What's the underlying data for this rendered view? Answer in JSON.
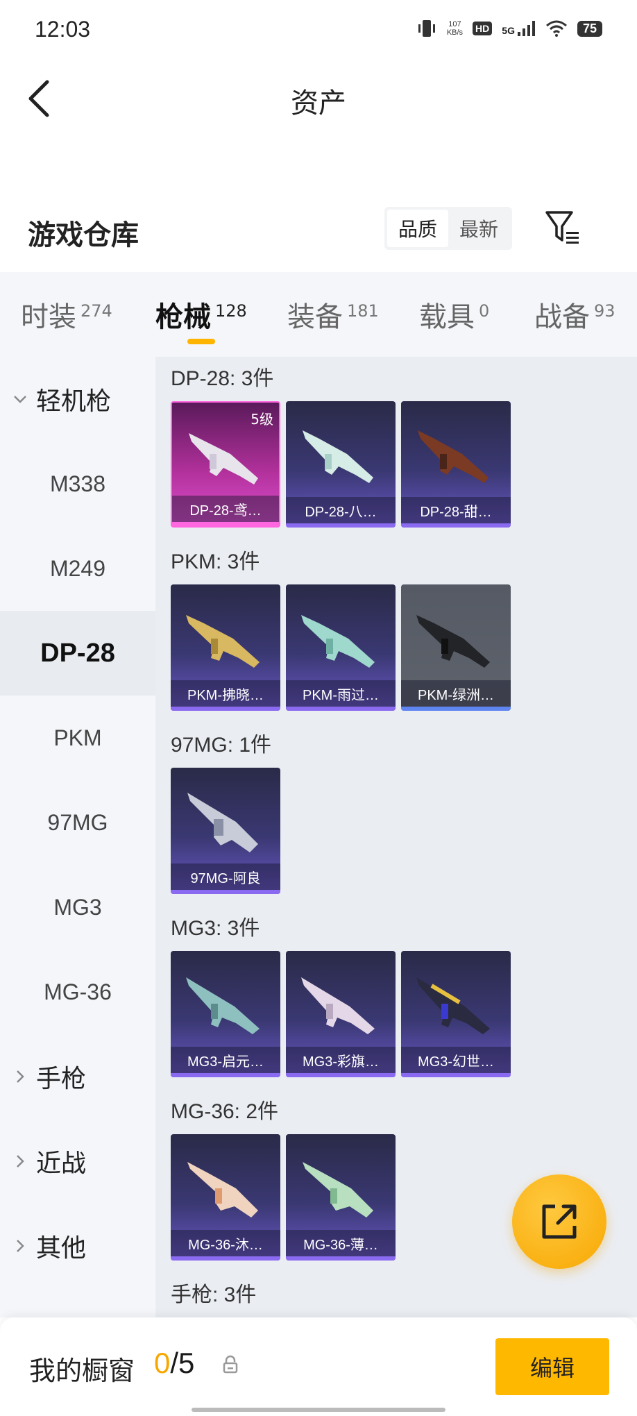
{
  "status_bar": {
    "time": "12:03",
    "net_speed_value": "107",
    "net_speed_unit": "KB/s",
    "hd_badge": "HD",
    "network": "5G",
    "battery": "75",
    "icons": [
      "vibrate-icon",
      "hd-icon",
      "signal-icon",
      "wifi-icon",
      "battery-icon"
    ]
  },
  "header": {
    "back_icon": "chevron-left-icon",
    "title": "资产"
  },
  "warehouse": {
    "title": "游戏仓库",
    "sort_options": [
      "品质",
      "最新"
    ],
    "sort_selected": "品质",
    "filter_icon": "filter-icon"
  },
  "tabs": [
    {
      "label": "时装",
      "count": "274"
    },
    {
      "label": "枪械",
      "count": "128",
      "active": true
    },
    {
      "label": "装备",
      "count": "181"
    },
    {
      "label": "载具",
      "count": "0"
    },
    {
      "label": "战备",
      "count": "93"
    }
  ],
  "sidebar": {
    "groups": [
      {
        "label": "轻机枪",
        "expanded": true
      },
      {
        "label": "手枪",
        "expanded": false
      },
      {
        "label": "近战",
        "expanded": false
      },
      {
        "label": "其他",
        "expanded": false
      }
    ],
    "items": [
      "M338",
      "M249",
      "DP-28",
      "PKM",
      "97MG",
      "MG3",
      "MG-36"
    ],
    "active_item": "DP-28"
  },
  "content": {
    "groups": [
      {
        "title": "DP-28: 3件",
        "cards": [
          {
            "label": "DP-28-鸢…",
            "level": "5级"
          },
          {
            "label": "DP-28-八…"
          },
          {
            "label": "DP-28-甜…"
          }
        ]
      },
      {
        "title": "PKM: 3件",
        "cards": [
          {
            "label": "PKM-拂晓…"
          },
          {
            "label": "PKM-雨过…"
          },
          {
            "label": "PKM-绿洲…"
          }
        ]
      },
      {
        "title": "97MG: 1件",
        "cards": [
          {
            "label": "97MG-阿良"
          }
        ]
      },
      {
        "title": "MG3: 3件",
        "cards": [
          {
            "label": "MG3-启元…"
          },
          {
            "label": "MG3-彩旗…"
          },
          {
            "label": "MG3-幻世…"
          }
        ]
      },
      {
        "title": "MG-36: 2件",
        "cards": [
          {
            "label": "MG-36-沐…"
          },
          {
            "label": "MG-36-薄…"
          }
        ]
      },
      {
        "title": "手枪: 3件",
        "cards": []
      }
    ]
  },
  "fab": {
    "icon": "share-external-icon"
  },
  "bottom_bar": {
    "showcase_label": "我的橱窗",
    "showcase_current": "0",
    "showcase_total": "/5",
    "lock_icon": "lock-icon",
    "edit_label": "编辑"
  },
  "colors": {
    "accent": "#ffb800",
    "card_purple": "#3a3872",
    "card_pink": "#e050d0",
    "card_gray": "#5e636c"
  }
}
